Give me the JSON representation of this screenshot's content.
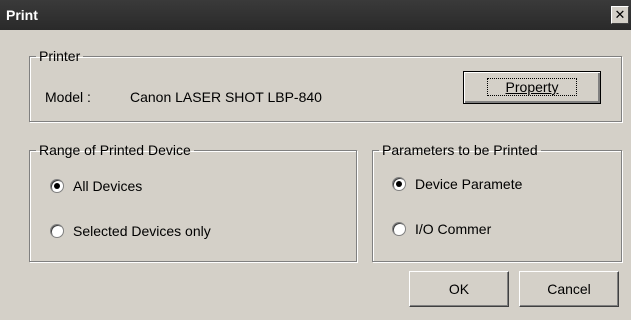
{
  "window": {
    "title": "Print",
    "close_glyph": "✕"
  },
  "printer_group": {
    "legend": "Printer",
    "model_label": "Model :",
    "model_value": "Canon LASER SHOT LBP-840",
    "property_button": "Property"
  },
  "range_group": {
    "legend": "Range of Printed Device",
    "options": [
      {
        "label": "All Devices",
        "checked": true
      },
      {
        "label": "Selected Devices only",
        "checked": false
      }
    ]
  },
  "params_group": {
    "legend": "Parameters to be Printed",
    "options": [
      {
        "label": "Device Paramete",
        "checked": true
      },
      {
        "label": "I/O Commer",
        "checked": false
      }
    ]
  },
  "buttons": {
    "ok": "OK",
    "cancel": "Cancel"
  }
}
